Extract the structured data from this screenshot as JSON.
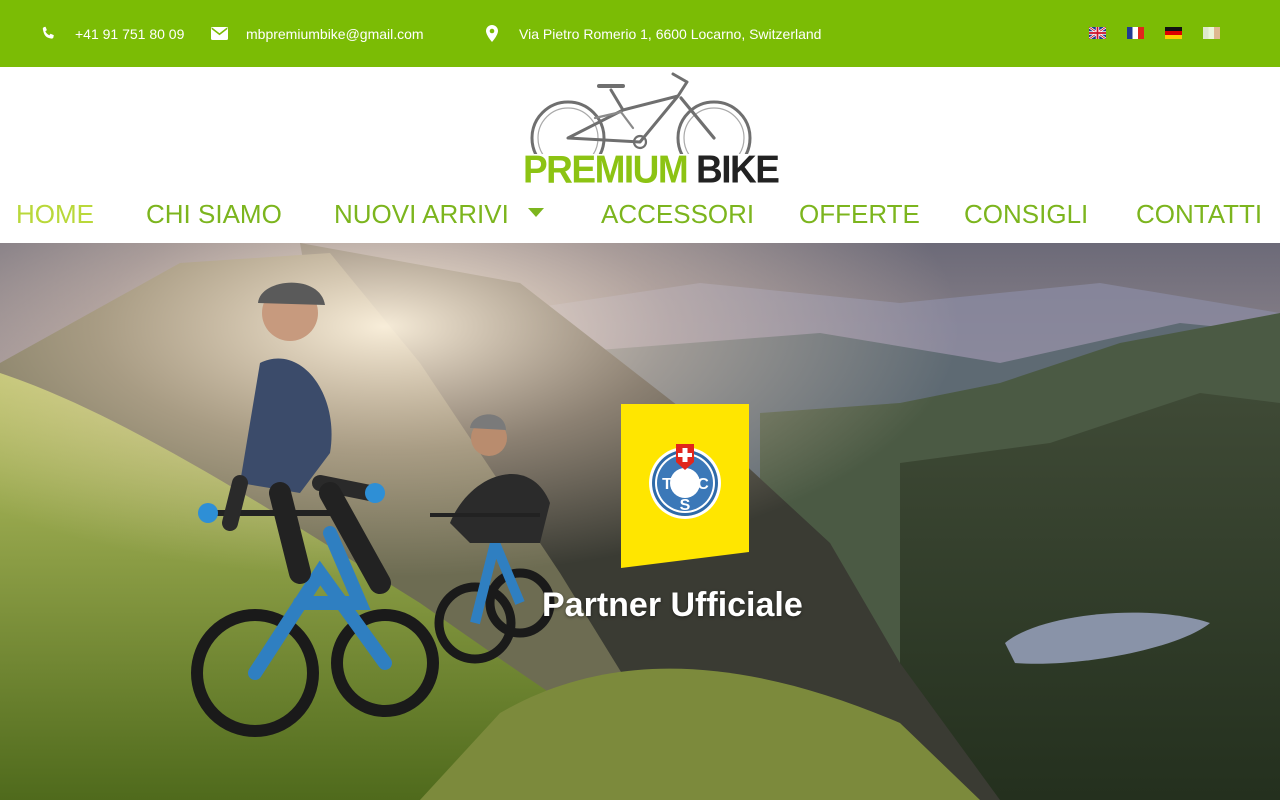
{
  "topbar": {
    "phone": "+41 91 751 80 09",
    "email": "mbpremiumbike@gmail.com",
    "address": "Via Pietro Romerio 1, 6600 Locarno, Switzerland",
    "languages": [
      "gb-flag-icon",
      "fr-flag-icon",
      "de-flag-icon",
      "it-flag-icon"
    ],
    "background": "#7bbc05"
  },
  "logo": {
    "word1": "PREMIUM",
    "word2": "BIKE"
  },
  "nav": {
    "items": [
      {
        "label": "HOME",
        "active": true
      },
      {
        "label": "CHI SIAMO"
      },
      {
        "label": "NUOVI ARRIVI",
        "has_dropdown": true
      },
      {
        "label": "ACCESSORI"
      },
      {
        "label": "OFFERTE"
      },
      {
        "label": "CONSIGLI"
      },
      {
        "label": "CONTATTI"
      }
    ],
    "color": "#7cb51e",
    "active_color": "#b9d83a"
  },
  "hero": {
    "badge_letters": [
      "T",
      "C",
      "S"
    ],
    "badge_color": "#ffe600",
    "caption": "Partner Ufficiale"
  }
}
